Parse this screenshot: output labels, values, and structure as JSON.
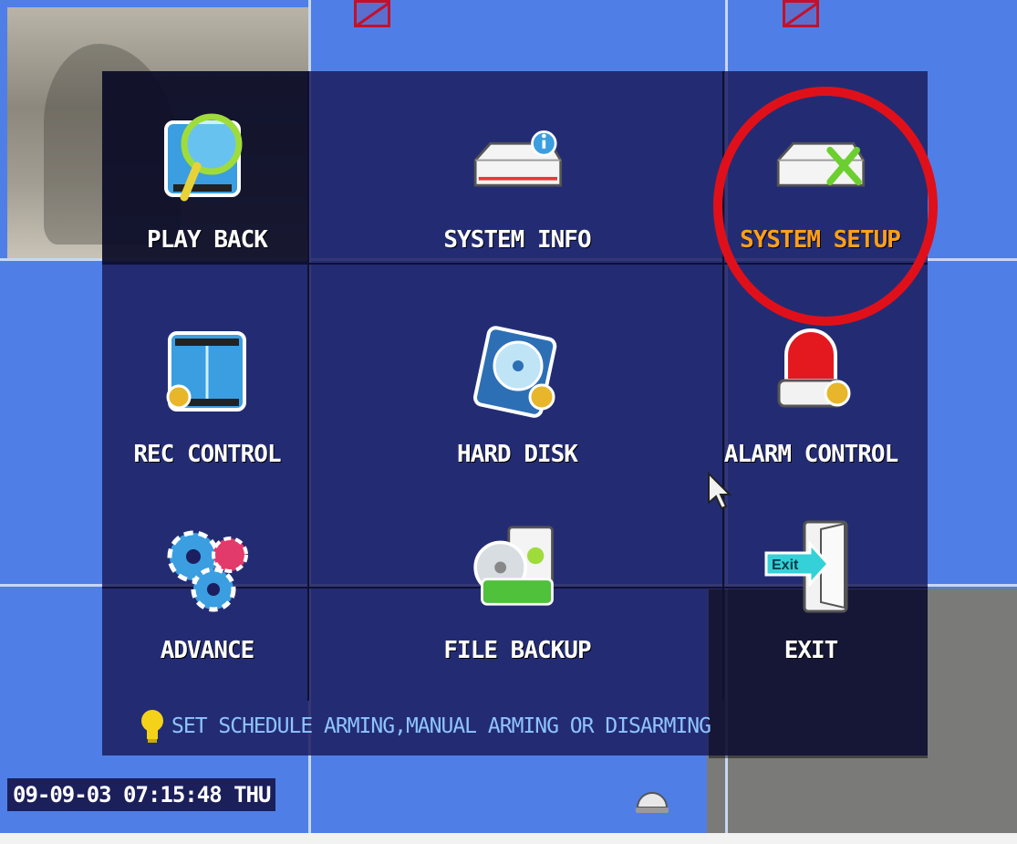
{
  "menu": {
    "items": [
      {
        "label": "PLAY BACK"
      },
      {
        "label": "SYSTEM INFO"
      },
      {
        "label": "SYSTEM SETUP"
      },
      {
        "label": "REC CONTROL"
      },
      {
        "label": "HARD DISK"
      },
      {
        "label": "ALARM CONTROL"
      },
      {
        "label": "ADVANCE"
      },
      {
        "label": "FILE BACKUP"
      },
      {
        "label": "EXIT"
      }
    ],
    "selected_label": "SYSTEM SETUP",
    "hint": "SET SCHEDULE ARMING,MANUAL ARMING OR DISARMING"
  },
  "icons": {
    "exit_sign": "Exit"
  },
  "status": {
    "datetime": "09-09-03 07:15:48 THU"
  },
  "colors": {
    "selected_label": "#ff9f1a",
    "label": "#ffffff",
    "hint_text": "#8fc4ff",
    "highlight_circle": "#e0101a",
    "background_grid": "#4f7fe6"
  }
}
